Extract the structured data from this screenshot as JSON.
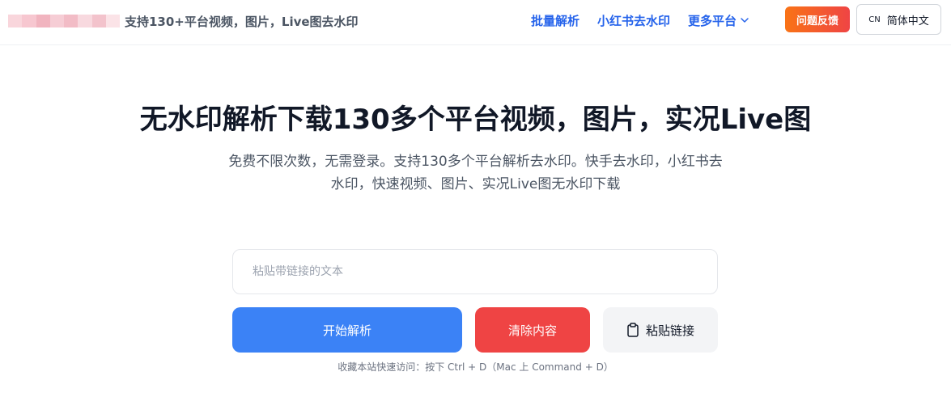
{
  "header": {
    "tagline": "支持130+平台视频，图片，Live图去水印",
    "logo_colors": [
      "#f9d6dc",
      "#f7c7d0",
      "#f1b4bf",
      "#f6cdd5",
      "#f2bcc6",
      "#f8d9df",
      "#f3c3cc",
      "#fbe3e7"
    ],
    "nav": [
      {
        "label": "批量解析"
      },
      {
        "label": "小红书去水印"
      },
      {
        "label": "更多平台",
        "icon": "chevron-down-icon"
      }
    ],
    "feedback_label": "问题反馈",
    "lang_code": "CN",
    "lang_label": "简体中文"
  },
  "hero": {
    "title": "无水印解析下载130多个平台视频，图片，实况Live图",
    "subtitle": "免费不限次数，无需登录。支持130多个平台解析去水印。快手去水印，小红书去水印，快速视频、图片、实况Live图无水印下载"
  },
  "form": {
    "input_value": "",
    "input_placeholder": "粘贴带链接的文本",
    "parse_label": "开始解析",
    "clear_label": "清除内容",
    "paste_label": "粘贴链接",
    "paste_icon": "clipboard-icon"
  },
  "hint": "收藏本站快速访问：按下 Ctrl + D（Mac 上 Command + D）",
  "colors": {
    "brand_blue": "#2563eb",
    "primary": "#3b82f6",
    "danger": "#ef4444",
    "feedback_start": "#f97316",
    "feedback_end": "#ef4444",
    "muted": "#f3f4f6"
  }
}
